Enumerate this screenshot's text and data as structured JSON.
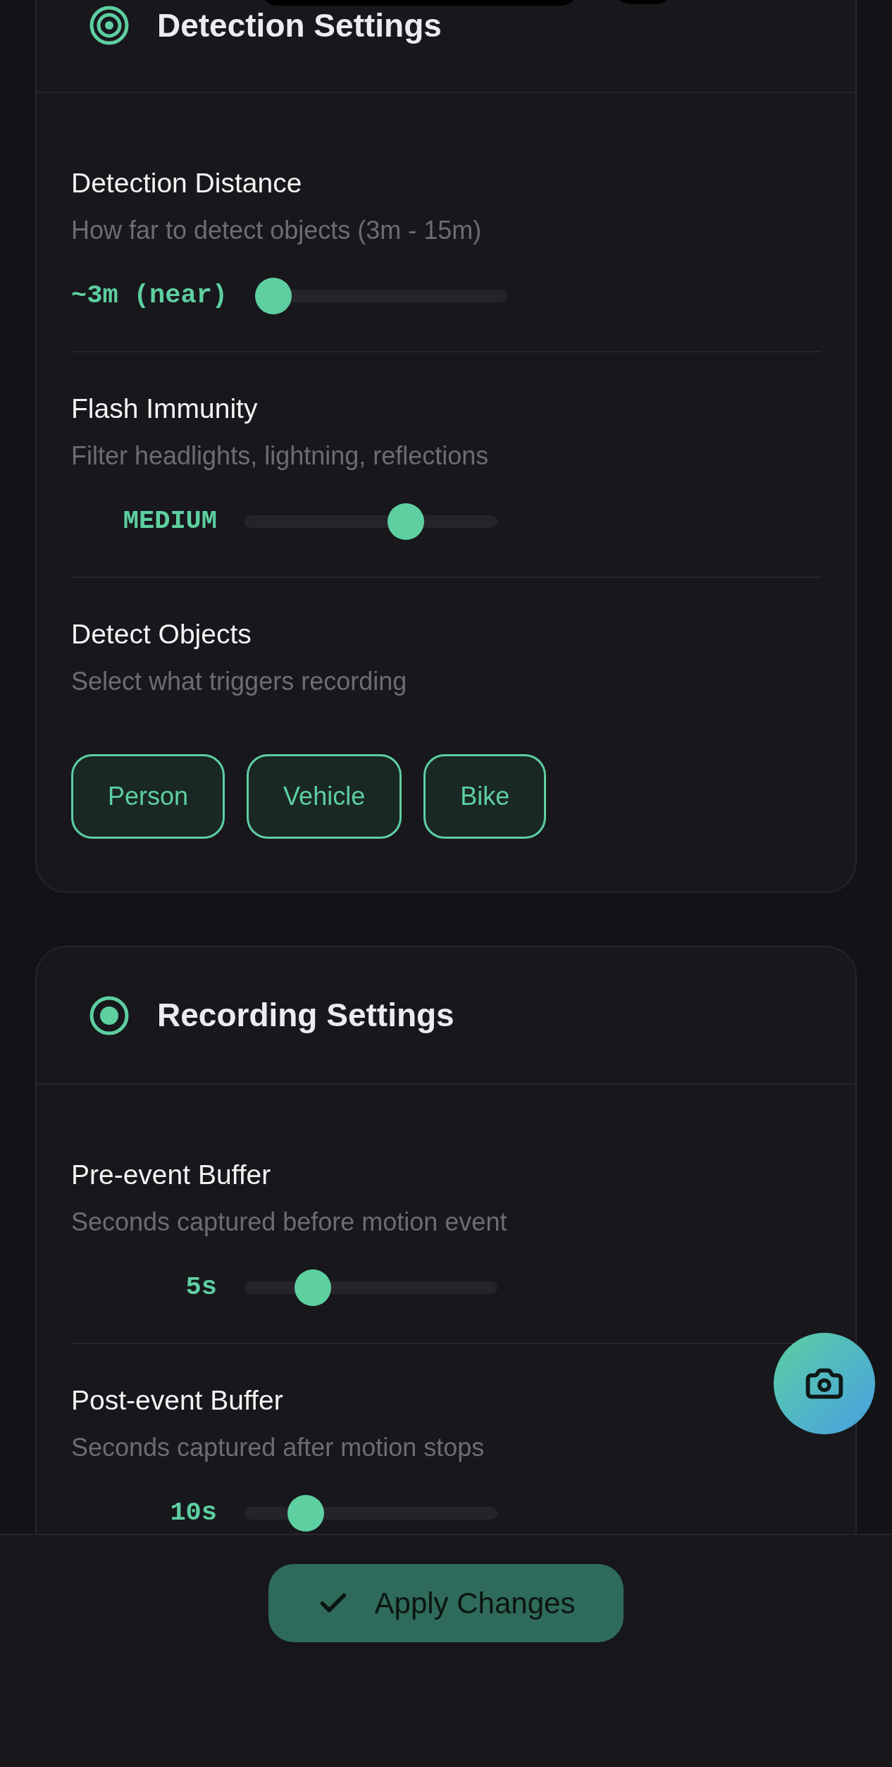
{
  "sections": [
    {
      "title": "Detection Settings",
      "settings": [
        {
          "kind": "slider",
          "label": "Detection Distance",
          "description": "How far to detect objects (3m - 15m)",
          "value": "~3m (near)",
          "level": 0
        },
        {
          "kind": "slider",
          "label": "Flash Immunity",
          "description": "Filter headlights, lightning, reflections",
          "value": "MEDIUM",
          "level": 0.66
        },
        {
          "kind": "chips",
          "label": "Detect Objects",
          "description": "Select what triggers recording",
          "options": [
            {
              "label": "Person",
              "selected": true
            },
            {
              "label": "Vehicle",
              "selected": true
            },
            {
              "label": "Bike",
              "selected": true
            }
          ]
        }
      ]
    },
    {
      "title": "Recording Settings",
      "settings": [
        {
          "kind": "slider",
          "label": "Pre-event Buffer",
          "description": "Seconds captured before motion event",
          "value": "5s",
          "level": 0.23
        },
        {
          "kind": "slider",
          "label": "Post-event Buffer",
          "description": "Seconds captured after motion stops",
          "value": "10s",
          "level": 0.2
        }
      ]
    }
  ],
  "apply_button": {
    "label": "Apply Changes"
  }
}
